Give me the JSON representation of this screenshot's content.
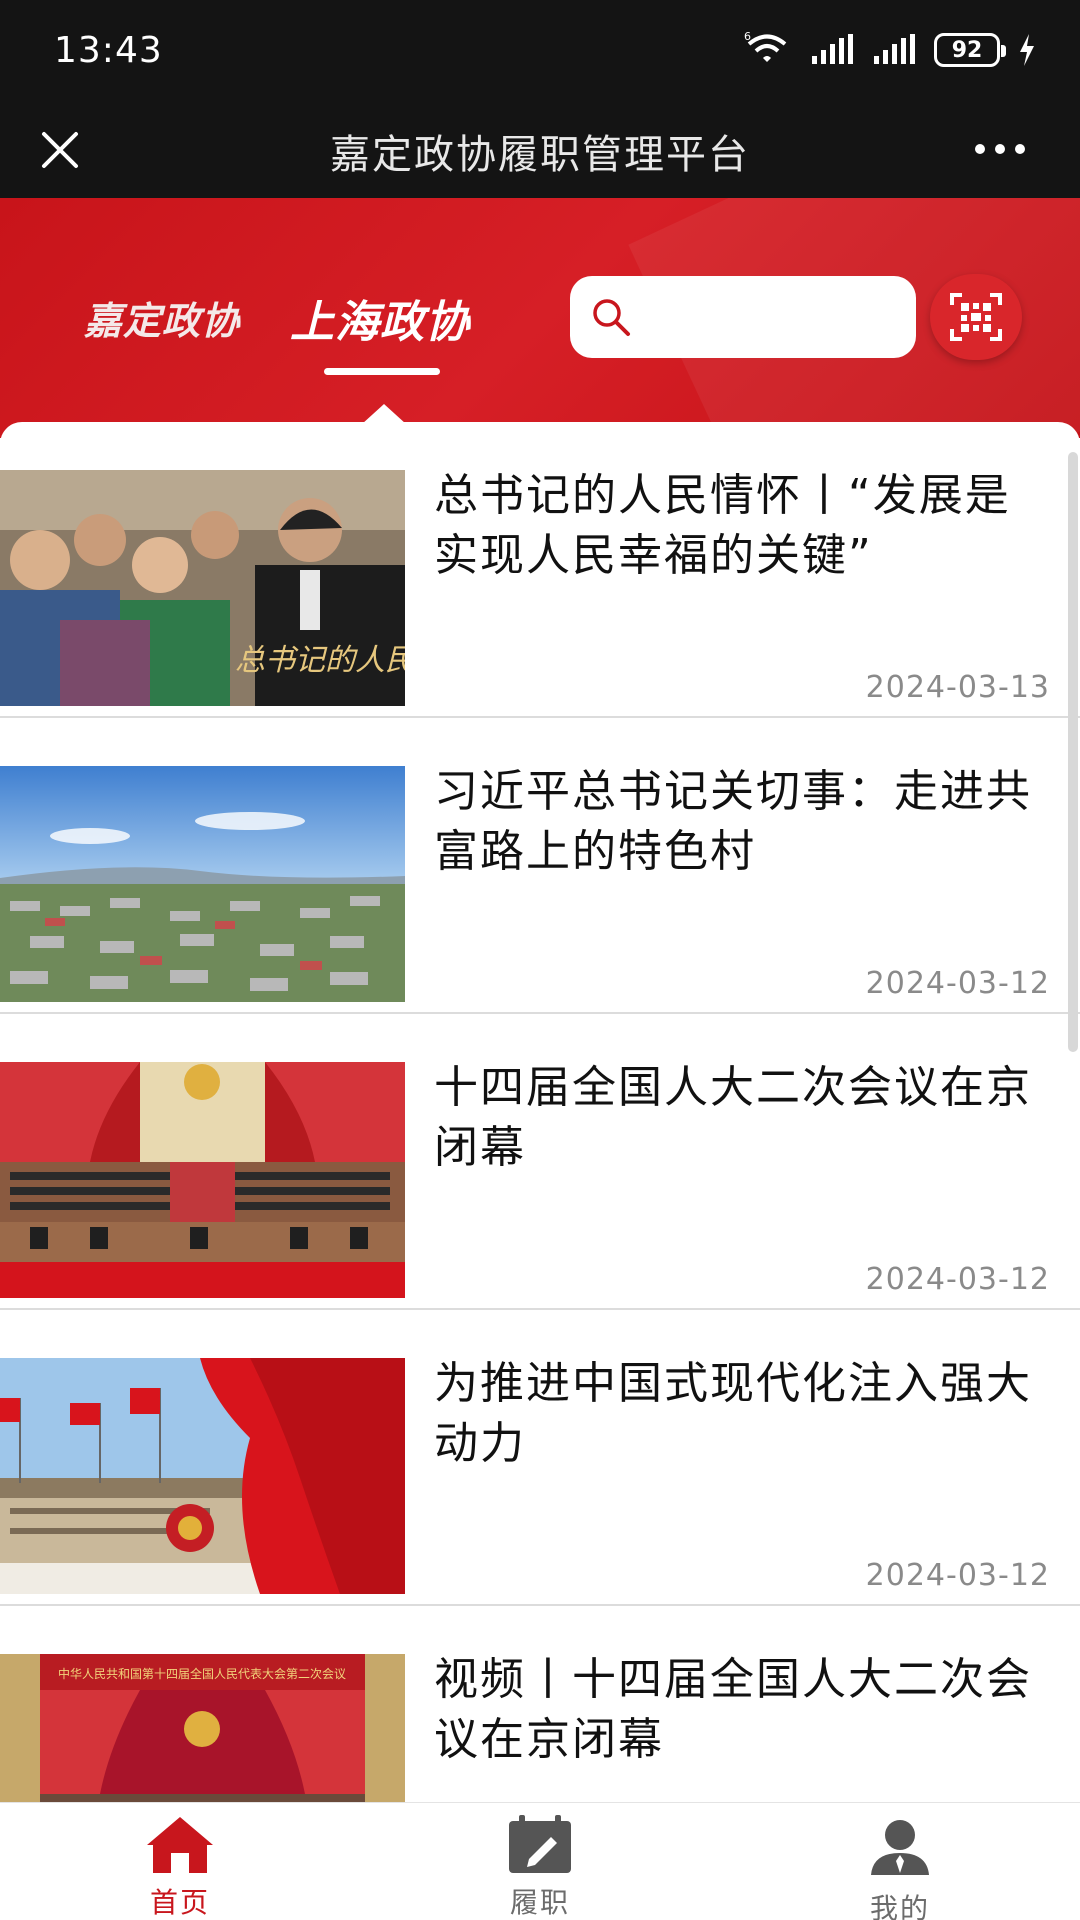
{
  "status_bar": {
    "time": "13:43",
    "battery": "92",
    "signal_badge": "6"
  },
  "title_bar": {
    "title": "嘉定政协履职管理平台"
  },
  "header": {
    "tabs": [
      {
        "label": "嘉定政协",
        "active": false
      },
      {
        "label": "上海政协",
        "active": true
      }
    ],
    "search": {
      "value": "",
      "placeholder": ""
    },
    "accent_color": "#d01a20"
  },
  "news": [
    {
      "title": "总书记的人民情怀丨“发展是实现人民幸福的关键”",
      "date": "2024-03-13",
      "thumb_caption": "总书记的人民情"
    },
    {
      "title": "习近平总书记关切事：走进共富路上的特色村",
      "date": "2024-03-12"
    },
    {
      "title": "十四届全国人大二次会议在京闭幕",
      "date": "2024-03-12"
    },
    {
      "title": "为推进中国式现代化注入强大动力",
      "date": "2024-03-12"
    },
    {
      "title": "视频丨十四届全国人大二次会议在京闭幕",
      "date": "",
      "thumb_caption": "中华人民共和国第十四届全国人民代表大会第二次会议"
    }
  ],
  "bottom_nav": [
    {
      "label": "首页",
      "icon": "home-icon",
      "active": true
    },
    {
      "label": "履职",
      "icon": "calendar-edit-icon",
      "active": false
    },
    {
      "label": "我的",
      "icon": "user-icon",
      "active": false
    }
  ]
}
